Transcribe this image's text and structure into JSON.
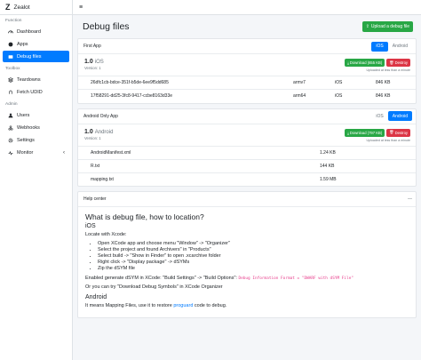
{
  "brand": {
    "logo": "Z",
    "name": "Zealot"
  },
  "sidebar": {
    "groups": [
      {
        "header": "Function",
        "items": [
          {
            "label": "Dashboard",
            "icon": "dashboard-icon"
          },
          {
            "label": "Apps",
            "icon": "apps-icon"
          },
          {
            "label": "Debug files",
            "icon": "debug-files-icon",
            "active": true
          }
        ]
      },
      {
        "header": "Toolbox",
        "items": [
          {
            "label": "Teardowns",
            "icon": "teardowns-icon"
          },
          {
            "label": "Fetch UDID",
            "icon": "fetch-udid-icon"
          }
        ]
      },
      {
        "header": "Admin",
        "items": [
          {
            "label": "Users",
            "icon": "users-icon"
          },
          {
            "label": "Webhooks",
            "icon": "webhooks-icon"
          },
          {
            "label": "Settings",
            "icon": "settings-icon"
          },
          {
            "label": "Monitor",
            "icon": "monitor-icon",
            "caret": "‹"
          }
        ]
      }
    ]
  },
  "topbar": {
    "menu_icon": "≡"
  },
  "page": {
    "title": "Debug files",
    "upload_label": "Upload a debug file"
  },
  "cards": [
    {
      "app_name": "First App",
      "tabs": [
        {
          "label": "iOS",
          "active": true
        },
        {
          "label": "Android",
          "active": false
        }
      ],
      "release": {
        "version": "1.0",
        "platform": "iOS",
        "version_sub": "Version: 1"
      },
      "download_label": "Download (655 KB)",
      "destroy_label": "Destroy",
      "uploaded_text": "Uploaded at less than a minute",
      "columns": 4,
      "rows": [
        [
          "26dfc1cb-bdce-351f-b5de-6ee9f5dd685",
          "armv7",
          "iOS",
          "846 KB"
        ],
        [
          "17f58291-dd25-3fc8-9417-ccbe8163d33e",
          "arm64",
          "iOS",
          "846 KB"
        ]
      ]
    },
    {
      "app_name": "Android Only App",
      "tabs": [
        {
          "label": "iOS",
          "active": false
        },
        {
          "label": "Android",
          "active": true
        }
      ],
      "release": {
        "version": "1.0",
        "platform": "Android",
        "version_sub": "Version: 1"
      },
      "download_label": "Download (797 KB)",
      "destroy_label": "Destroy",
      "uploaded_text": "Uploaded at less than a minute",
      "columns": 2,
      "rows": [
        [
          "AndroidManifest.xml",
          "1.24 KB"
        ],
        [
          "R.txt",
          "144 KB"
        ],
        [
          "mapping.txt",
          "1.59 MB"
        ]
      ]
    }
  ],
  "help": {
    "header": "Help center",
    "collapse": "—",
    "title": "What is debug file, how to location?",
    "ios_heading": "iOS",
    "locate": "Locate with Xcode:",
    "steps": [
      "Open XCode app and choose menu \"Window\" -> \"Organizer\"",
      "Select the project and found Archivers\" in \"Products\"",
      "Select build -> \"Show in Finder\" to open .xcarchive folder",
      "Right click -> \"Display package\" -> dSYMs",
      "Zip the dSYM file"
    ],
    "enable_prefix": "Enabled generate dSYM in XCode: \"Build Settings\" -> \"Build Options\":",
    "enable_code": "Debug Information Format = \"DWARF with dSYM File\"",
    "organizer": "Or you can try \"Download Debug Symbols\" in XCode Organizer",
    "android_heading": "Android",
    "android_prefix": "It means Mapping Files, use it to restore",
    "android_link": "proguard",
    "android_suffix": "code to debug."
  },
  "colors": {
    "primary": "#007bff",
    "success": "#28a745",
    "danger": "#dc3545",
    "code": "#e83e8c"
  }
}
